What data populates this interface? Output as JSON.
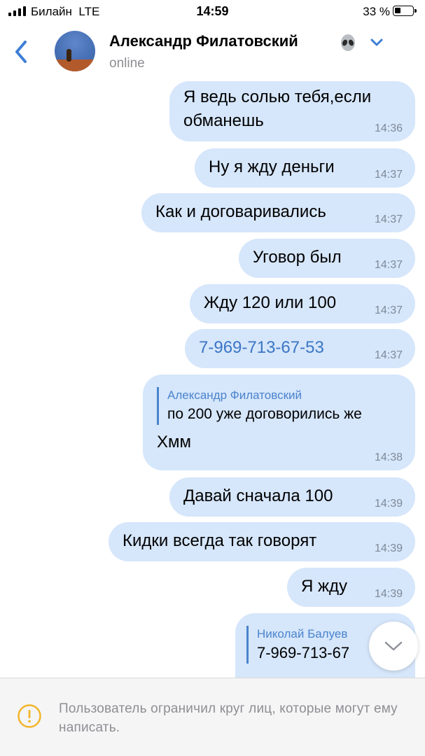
{
  "status_bar": {
    "carrier": "Билайн",
    "network": "LTE",
    "time": "14:59",
    "battery": "33 %"
  },
  "header": {
    "contact_name": "Александр Филатовский",
    "status": "online",
    "name_icon": "alien-icon"
  },
  "messages": [
    {
      "text": "Я ведь солью тебя,если обманешь",
      "time": "14:36"
    },
    {
      "text": "Ну я жду деньги",
      "time": "14:37"
    },
    {
      "text": "Как и договаривались",
      "time": "14:37"
    },
    {
      "text": "Уговор был",
      "time": "14:37"
    },
    {
      "text": "Жду 120 или 100",
      "time": "14:37"
    },
    {
      "text": "7-969-713-67-53",
      "time": "14:37",
      "is_link": true
    },
    {
      "reply_author": "Александр Филатовский",
      "reply_text": "по 200 уже договорились же",
      "text": "Хмм",
      "time": "14:38"
    },
    {
      "text": "Давай сначала 100",
      "time": "14:39"
    },
    {
      "text": "Кидки всегда так говорят",
      "time": "14:39"
    },
    {
      "text": "Я жду",
      "time": "14:39"
    },
    {
      "reply_author": "Николай Балуев",
      "reply_text": "7-969-713-67"
    }
  ],
  "footer": {
    "notice": "Пользователь ограничил круг лиц, которые могут ему написать.",
    "icon": "warning-icon"
  },
  "colors": {
    "bubble": "#d6e6fb",
    "accent": "#4a84cc",
    "time": "#7e8a98",
    "muted": "#8e8e93"
  }
}
